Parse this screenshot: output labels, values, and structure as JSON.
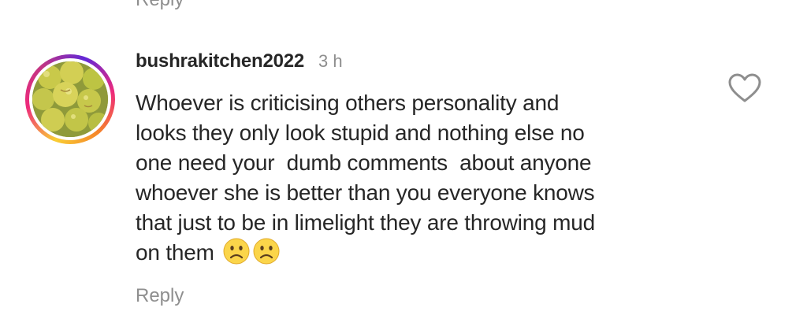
{
  "previous_comment": {
    "reply_label": "Reply"
  },
  "comment": {
    "username": "bushrakitchen2022",
    "timestamp": "3 h",
    "text_lines": [
      "Whoever is criticising others personality and",
      "looks they only look stupid and nothing else no",
      "one need your  dumb comments  about anyone",
      "whoever she is better than you everyone knows",
      "that just to be in limelight they are throwing mud",
      "on them"
    ],
    "emojis": [
      "slightly-frowning-face-emoji",
      "slightly-frowning-face-emoji"
    ],
    "reply_label": "Reply",
    "like_icon": "heart-outline-icon"
  },
  "colors": {
    "text_primary": "#262626",
    "text_secondary": "#8e8e8e",
    "background": "#ffffff",
    "emoji_face": "#fbd54a"
  }
}
